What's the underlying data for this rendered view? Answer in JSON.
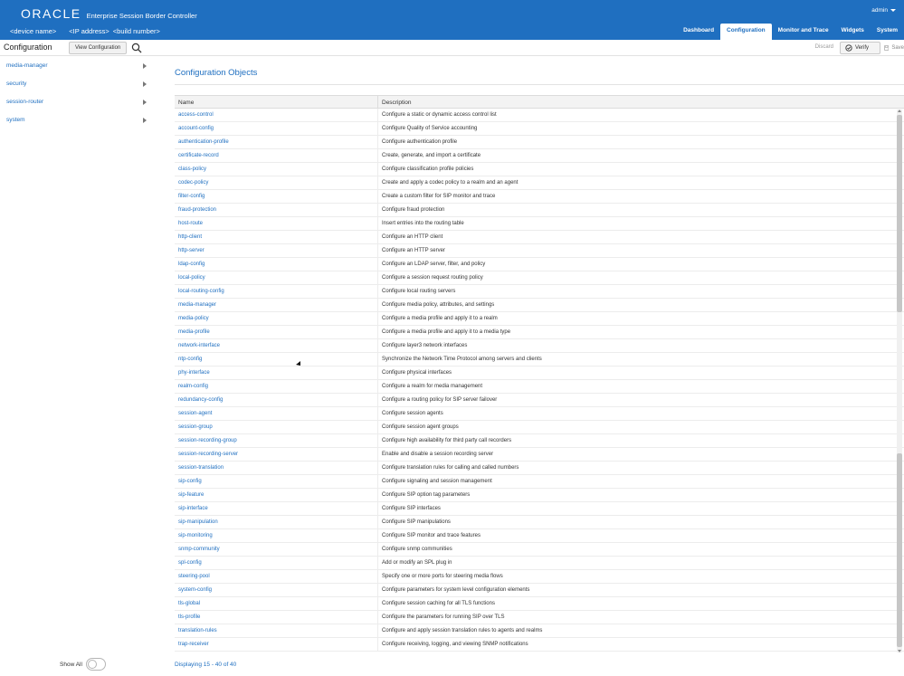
{
  "banner": {
    "brand": "ORACLE",
    "product": "Enterprise Session Border Controller",
    "user": "admin",
    "device_name": "<device name>",
    "ip_address": "<IP address>",
    "build_number": "<build number>",
    "tabs": [
      {
        "label": "Dashboard",
        "active": false
      },
      {
        "label": "Configuration",
        "active": true
      },
      {
        "label": "Monitor and Trace",
        "active": false
      },
      {
        "label": "Widgets",
        "active": false
      },
      {
        "label": "System",
        "active": false
      }
    ]
  },
  "toolbar": {
    "title": "Configuration",
    "view_config_label": "View Configuration",
    "discard_label": "Discard",
    "verify_label": "Verify",
    "save_label": "Save"
  },
  "sidebar": {
    "items": [
      {
        "label": "media-manager"
      },
      {
        "label": "security"
      },
      {
        "label": "session-router"
      },
      {
        "label": "system"
      }
    ],
    "show_all_label": "Show All"
  },
  "main": {
    "section_title": "Configuration Objects",
    "columns": {
      "name": "Name",
      "description": "Description"
    },
    "rows": [
      {
        "name": "access-control",
        "desc": "Configure a static or dynamic access control list"
      },
      {
        "name": "account-config",
        "desc": "Configure Quality of Service accounting"
      },
      {
        "name": "authentication-profile",
        "desc": "Configure authentication profile"
      },
      {
        "name": "certificate-record",
        "desc": "Create, generate, and import a certificate"
      },
      {
        "name": "class-policy",
        "desc": "Configure classification profile policies"
      },
      {
        "name": "codec-policy",
        "desc": "Create and apply a codec policy to a realm and an agent"
      },
      {
        "name": "filter-config",
        "desc": "Create a custom filter for SIP monitor and trace"
      },
      {
        "name": "fraud-protection",
        "desc": "Configure fraud protection"
      },
      {
        "name": "host-route",
        "desc": "Insert entries into the routing table"
      },
      {
        "name": "http-client",
        "desc": "Configure an HTTP client"
      },
      {
        "name": "http-server",
        "desc": "Configure an HTTP server"
      },
      {
        "name": "ldap-config",
        "desc": "Configure an LDAP server, filter, and policy"
      },
      {
        "name": "local-policy",
        "desc": "Configure a session request routing policy"
      },
      {
        "name": "local-routing-config",
        "desc": "Configure local routing servers"
      },
      {
        "name": "media-manager",
        "desc": "Configure media policy, attributes, and settings"
      },
      {
        "name": "media-policy",
        "desc": "Configure a media profile and apply it to a realm"
      },
      {
        "name": "media-profile",
        "desc": "Configure a media profile and apply it to a media type"
      },
      {
        "name": "network-interface",
        "desc": "Configure layer3 network interfaces"
      },
      {
        "name": "ntp-config",
        "desc": "Synchronize the Network Time Protocol among servers and clients"
      },
      {
        "name": "phy-interface",
        "desc": "Configure physical interfaces"
      },
      {
        "name": "realm-config",
        "desc": "Configure a realm for media management"
      },
      {
        "name": "redundancy-config",
        "desc": "Configure a routing policy for SIP server failover"
      },
      {
        "name": "session-agent",
        "desc": "Configure session agents"
      },
      {
        "name": "session-group",
        "desc": "Configure session agent groups"
      },
      {
        "name": "session-recording-group",
        "desc": "Configure high availability for third party call recorders"
      },
      {
        "name": "session-recording-server",
        "desc": "Enable and disable a session recording server"
      },
      {
        "name": "session-translation",
        "desc": "Configure translation rules for calling and called numbers"
      },
      {
        "name": "sip-config",
        "desc": "Configure signaling and session management"
      },
      {
        "name": "sip-feature",
        "desc": "Configure SIP option tag parameters"
      },
      {
        "name": "sip-interface",
        "desc": "Configure SIP interfaces"
      },
      {
        "name": "sip-manipulation",
        "desc": "Configure SIP manipulations"
      },
      {
        "name": "sip-monitoring",
        "desc": "Configure SIP monitor and trace features"
      },
      {
        "name": "snmp-community",
        "desc": "Configure snmp communities"
      },
      {
        "name": "spl-config",
        "desc": "Add or modify an SPL plug in"
      },
      {
        "name": "steering-pool",
        "desc": "Specify one or more ports for steering media flows"
      },
      {
        "name": "system-config",
        "desc": "Configure parameters for system level configuration elements"
      },
      {
        "name": "tls-global",
        "desc": "Configure session caching for all TLS functions"
      },
      {
        "name": "tls-profile",
        "desc": "Configure the parameters for running SIP over TLS"
      },
      {
        "name": "translation-rules",
        "desc": "Configure and apply session translation rules to agents and realms"
      },
      {
        "name": "trap-receiver",
        "desc": "Configure receiving, logging, and viewing SNMP notifications"
      }
    ],
    "footer": "Displaying 15 - 40 of 40"
  },
  "colors": {
    "brand_blue": "#1f6fc0",
    "link_blue": "#1f6fc0",
    "header_bg": "#f3f3f3"
  },
  "icons": {
    "search": "search-icon",
    "verify": "check-circle-icon",
    "save": "save-icon",
    "user_menu": "chevron-down-icon",
    "sidebar_expand": "arrow-right-icon"
  }
}
